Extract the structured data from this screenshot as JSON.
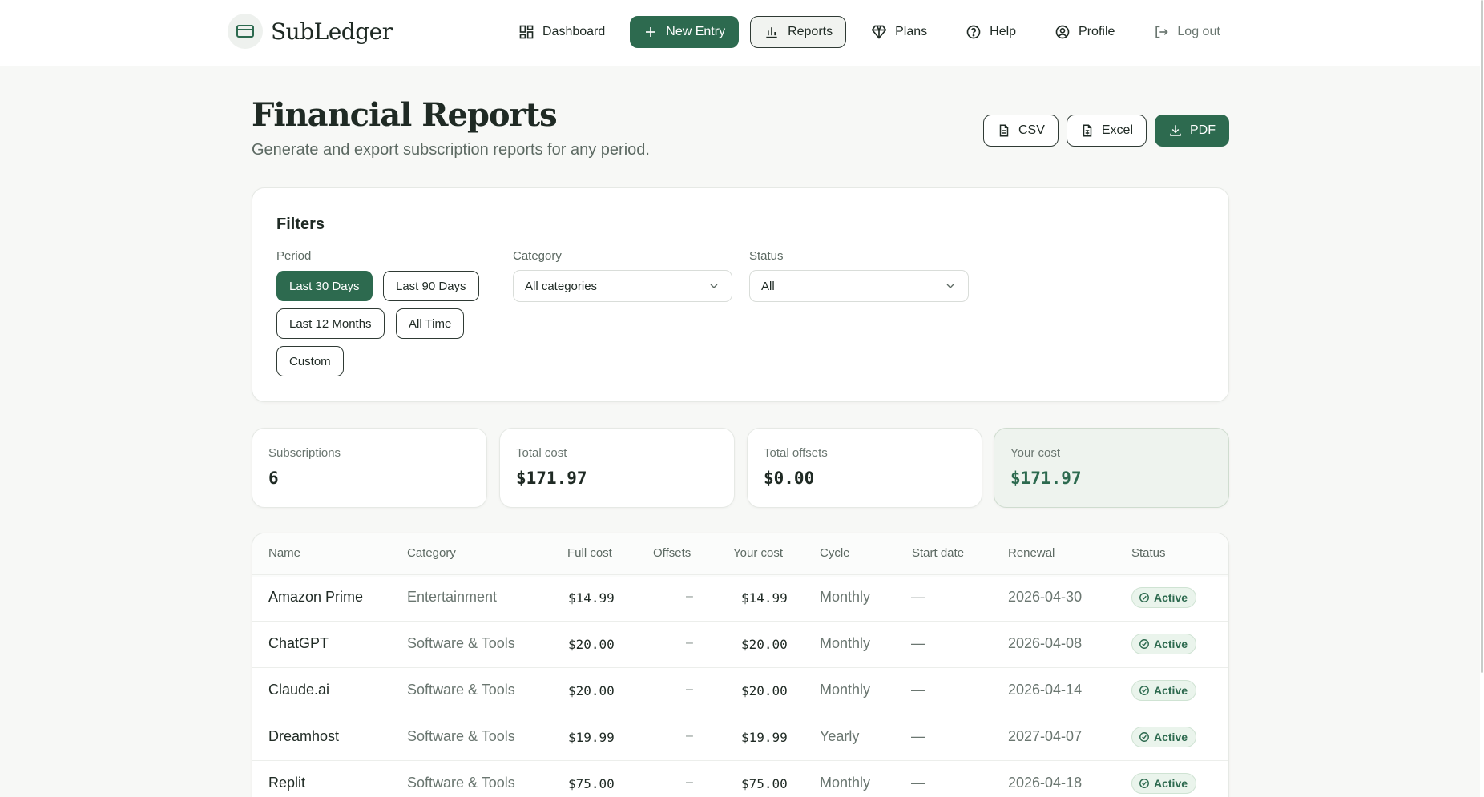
{
  "brand": {
    "name": "SubLedger"
  },
  "nav": {
    "dashboard": "Dashboard",
    "new_entry": "New Entry",
    "reports": "Reports",
    "plans": "Plans",
    "help": "Help",
    "profile": "Profile",
    "logout": "Log out"
  },
  "page": {
    "title": "Financial Reports",
    "subtitle": "Generate and export subscription reports for any period."
  },
  "export": {
    "csv": "CSV",
    "excel": "Excel",
    "pdf": "PDF"
  },
  "filters": {
    "title": "Filters",
    "period_label": "Period",
    "periods": [
      "Last 30 Days",
      "Last 90 Days",
      "Last 12 Months",
      "All Time",
      "Custom"
    ],
    "selected_period": "Last 30 Days",
    "category_label": "Category",
    "category_value": "All categories",
    "status_label": "Status",
    "status_value": "All"
  },
  "stats": {
    "subscriptions": {
      "label": "Subscriptions",
      "value": "6"
    },
    "total_cost": {
      "label": "Total cost",
      "value": "$171.97"
    },
    "total_offsets": {
      "label": "Total offsets",
      "value": "$0.00"
    },
    "your_cost": {
      "label": "Your cost",
      "value": "$171.97"
    }
  },
  "table": {
    "headers": [
      "Name",
      "Category",
      "Full cost",
      "Offsets",
      "Your cost",
      "Cycle",
      "Start date",
      "Renewal",
      "Status"
    ],
    "rows": [
      {
        "name": "Amazon Prime",
        "category": "Entertainment",
        "full_cost": "$14.99",
        "offsets": "–",
        "your_cost": "$14.99",
        "cycle": "Monthly",
        "start": "—",
        "renewal": "2026-04-30",
        "status": "Active"
      },
      {
        "name": "ChatGPT",
        "category": "Software & Tools",
        "full_cost": "$20.00",
        "offsets": "–",
        "your_cost": "$20.00",
        "cycle": "Monthly",
        "start": "—",
        "renewal": "2026-04-08",
        "status": "Active"
      },
      {
        "name": "Claude.ai",
        "category": "Software & Tools",
        "full_cost": "$20.00",
        "offsets": "–",
        "your_cost": "$20.00",
        "cycle": "Monthly",
        "start": "—",
        "renewal": "2026-04-14",
        "status": "Active"
      },
      {
        "name": "Dreamhost",
        "category": "Software & Tools",
        "full_cost": "$19.99",
        "offsets": "–",
        "your_cost": "$19.99",
        "cycle": "Yearly",
        "start": "—",
        "renewal": "2027-04-07",
        "status": "Active"
      },
      {
        "name": "Replit",
        "category": "Software & Tools",
        "full_cost": "$75.00",
        "offsets": "–",
        "your_cost": "$75.00",
        "cycle": "Monthly",
        "start": "—",
        "renewal": "2026-04-18",
        "status": "Active"
      }
    ]
  },
  "colors": {
    "accent": "#2d6a4f",
    "background": "#f7f8f6",
    "badge_bg": "#eaf4ec"
  }
}
